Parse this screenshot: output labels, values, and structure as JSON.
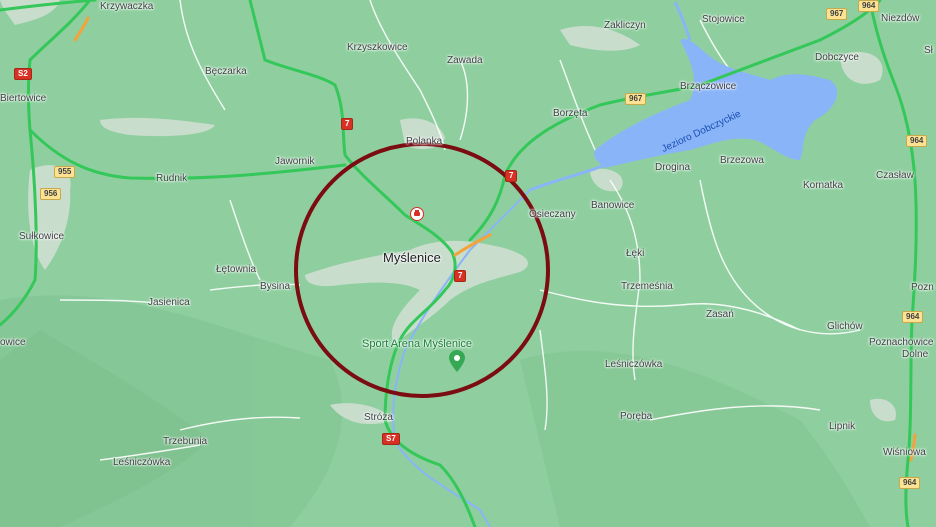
{
  "map": {
    "colors": {
      "land": "#8fcf9f",
      "lake": "#8ab4f8",
      "road_green": "#34c759",
      "road_orange": "#f4a23c",
      "circle": "#7a0c12"
    },
    "labels": {
      "krzywaczka": "Krzywaczka",
      "krzyszkowice": "Krzyszkowice",
      "zakliczyn": "Zakliczyn",
      "stojowice": "Stojowice",
      "niezdow": "Niezdów",
      "zawada": "Zawada",
      "beczarka": "Bęczarka",
      "dobczyce": "Dobczyce",
      "brzaczowice": "Brzączowice",
      "biertowice": "Biertowice",
      "borzeta": "Borzęta",
      "polanka": "Polanka",
      "jeziora_dobczyckie": "Jezioro Dobczyckie",
      "jawornik": "Jawornik",
      "rudnik": "Rudnik",
      "brzezowa": "Brzezowa",
      "drogina": "Drogina",
      "czaslaw": "Czasław",
      "kornatka": "Kornatka",
      "banowice": "Banowice",
      "osieczany": "Osieczany",
      "sulkowice": "Sułkowice",
      "letownia": "Łętownia",
      "myslenice": "Myślenice",
      "leki": "Łęki",
      "bysina": "Bysina",
      "trzemesnia": "Trzemeśnia",
      "jasienica": "Jasienica",
      "zasan": "Zasań",
      "glichow": "Glichów",
      "sport_arena": "Sport Arena Myślenice",
      "poznachowice": "Poznachowice",
      "dolne": "Dolne",
      "owice": "owice",
      "lesniczowka_e": "Leśniczówka",
      "poreba": "Poręba",
      "stroza": "Stróża",
      "trzebunia": "Trzebunia",
      "lipnik": "Lipnik",
      "lesniczowka_w": "Leśniczówka",
      "wisniowa": "Wiśniowa",
      "pozn_edge": "Pozn",
      "sl_edge": "Sł"
    },
    "shields": {
      "s52": "S2",
      "r955": "955",
      "r956": "956",
      "r7a": "7",
      "r7b": "7",
      "r7c": "7",
      "r967a": "967",
      "r967b": "967",
      "r964a": "964",
      "r964b": "964",
      "r964c": "964",
      "r964d": "964",
      "s7": "S7"
    },
    "icons": {
      "pin": "location-pin-icon",
      "event": "event-icon"
    }
  }
}
